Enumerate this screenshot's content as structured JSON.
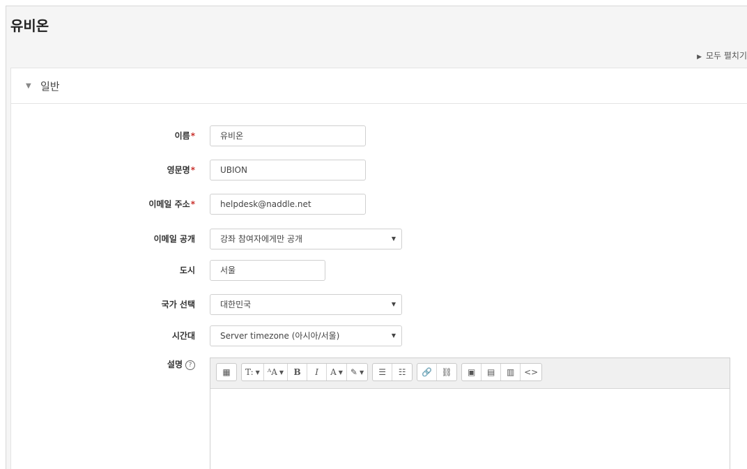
{
  "page": {
    "title": "유비온",
    "expand_all": "모두 펼치기"
  },
  "section": {
    "legend": "일반"
  },
  "fields": {
    "name": {
      "label": "이름",
      "required_mark": "*",
      "value": "유비온"
    },
    "english_name": {
      "label": "영문명",
      "required_mark": "*",
      "value": "UBION"
    },
    "email": {
      "label": "이메일 주소",
      "required_mark": "*",
      "value": "helpdesk@naddle.net"
    },
    "email_display": {
      "label": "이메일 공개",
      "value": "강좌 참여자에게만 공개"
    },
    "city": {
      "label": "도시",
      "value": "서울"
    },
    "country": {
      "label": "국가 선택",
      "value": "대한민국"
    },
    "timezone": {
      "label": "시간대",
      "value": "Server timezone (아시아/서울)"
    },
    "description": {
      "label": "설명",
      "help_glyph": "?"
    }
  },
  "editor_toolbar": {
    "glyphs": {
      "toggle": "▦",
      "title": "T:",
      "font_size": "ᴬA",
      "bold": "B",
      "italic": "I",
      "font_color": "A",
      "highlight": "✎",
      "ul": "☰",
      "ol": "☷",
      "link": "🔗",
      "unlink": "⛓",
      "image": "▣",
      "media": "▤",
      "video": "▥",
      "html": "<>"
    },
    "dropdown_glyph": "▼"
  },
  "icons": {
    "expand_triangle": "▶",
    "section_caret": "▼",
    "select_arrow": "▼"
  },
  "colors": {
    "required": "#c9302c",
    "background": "#f5f5f5"
  }
}
